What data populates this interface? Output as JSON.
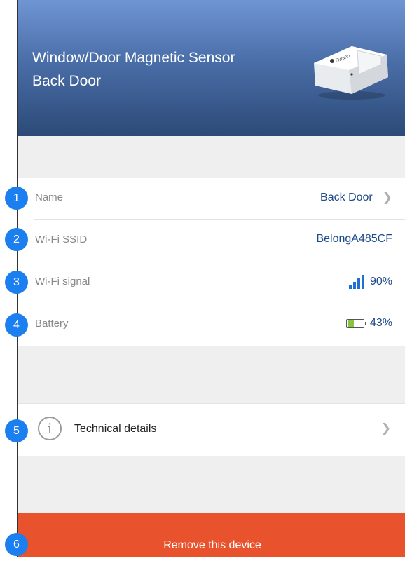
{
  "header": {
    "title_line1": "Window/Door Magnetic Sensor",
    "title_line2": "Back Door",
    "device_image": "sensor-image",
    "brand_mark": "Swann"
  },
  "details": [
    {
      "label": "Name",
      "value": "Back Door",
      "icon": "chevron-right-icon"
    },
    {
      "label": "Wi-Fi SSID",
      "value": "BelongA485CF"
    },
    {
      "label": "Wi-Fi signal",
      "value": "90%",
      "icon": "signal-bars-icon",
      "level": 0.9
    },
    {
      "label": "Battery",
      "value": "43%",
      "icon": "battery-icon",
      "level": 0.43
    }
  ],
  "technical": {
    "label": "Technical details",
    "icon": "info-icon"
  },
  "remove": {
    "label": "Remove this device"
  },
  "badges": [
    "1",
    "2",
    "3",
    "4",
    "5",
    "6"
  ],
  "colors": {
    "accent": "#1d4a8a",
    "badge": "#1b7ff0",
    "danger": "#e8532e",
    "battery": "#8ac43f",
    "signal": "#1e6fd8"
  }
}
